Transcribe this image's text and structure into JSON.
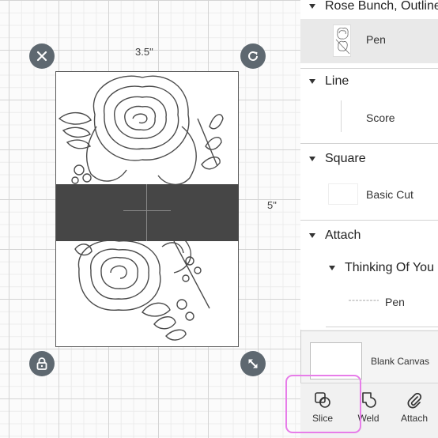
{
  "canvas": {
    "width_label": "3.5\"",
    "height_label": "5\""
  },
  "layers": {
    "groups": [
      {
        "title": "Rose Bunch, Outline",
        "items": [
          {
            "label": "Pen",
            "thumb": "rose-thumbnail-icon"
          }
        ]
      },
      {
        "title": "Line",
        "items": [
          {
            "label": "Score",
            "thumb": "line-thumbnail-icon"
          }
        ]
      },
      {
        "title": "Square",
        "items": [
          {
            "label": "Basic Cut",
            "thumb": "square-thumbnail-icon"
          }
        ]
      },
      {
        "title": "Attach",
        "subgroup": {
          "title": "Thinking Of You",
          "items": [
            {
              "label": "Pen",
              "thumb": "text-thumbnail-icon"
            }
          ]
        }
      }
    ],
    "blank_canvas": "Blank Canvas"
  },
  "tools": [
    {
      "label": "Slice",
      "icon": "slice-icon"
    },
    {
      "label": "Weld",
      "icon": "weld-icon"
    },
    {
      "label": "Attach",
      "icon": "paperclip-icon"
    }
  ],
  "colors": {
    "band": "#464646",
    "handle": "#5e6870",
    "highlight": "#e77de9"
  }
}
